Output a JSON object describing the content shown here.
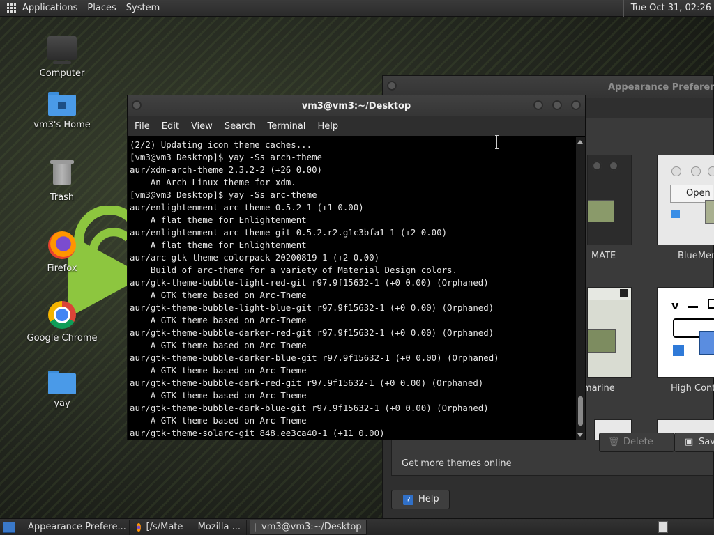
{
  "top_panel": {
    "menus": [
      "Applications",
      "Places",
      "System"
    ],
    "clock": "Tue Oct 31, 02:26"
  },
  "desktop_icons": [
    {
      "label": "Computer",
      "icon": "computer-icon"
    },
    {
      "label": "vm3's Home",
      "icon": "home-folder-icon"
    },
    {
      "label": "Trash",
      "icon": "trash-icon"
    },
    {
      "label": "Firefox",
      "icon": "firefox-icon"
    },
    {
      "label": "Google Chrome",
      "icon": "chrome-icon"
    },
    {
      "label": "yay",
      "icon": "folder-icon"
    }
  ],
  "terminal": {
    "title": "vm3@vm3:~/Desktop",
    "menu": [
      "File",
      "Edit",
      "View",
      "Search",
      "Terminal",
      "Help"
    ],
    "lines": [
      "(2/2) Updating icon theme caches...",
      "[vm3@vm3 Desktop]$ yay -Ss arch-theme",
      "aur/xdm-arch-theme 2.3.2-2 (+26 0.00)",
      "    An Arch Linux theme for xdm.",
      "[vm3@vm3 Desktop]$ yay -Ss arc-theme",
      "aur/enlightenment-arc-theme 0.5.2-1 (+1 0.00)",
      "    A flat theme for Enlightenment",
      "aur/enlightenment-arc-theme-git 0.5.2.r2.g1c3bfa1-1 (+2 0.00)",
      "    A flat theme for Enlightenment",
      "aur/arc-gtk-theme-colorpack 20200819-1 (+2 0.00)",
      "    Build of arc-theme for a variety of Material Design colors.",
      "aur/gtk-theme-bubble-light-red-git r97.9f15632-1 (+0 0.00) (Orphaned)",
      "    A GTK theme based on Arc-Theme",
      "aur/gtk-theme-bubble-light-blue-git r97.9f15632-1 (+0 0.00) (Orphaned)",
      "    A GTK theme based on Arc-Theme",
      "aur/gtk-theme-bubble-darker-red-git r97.9f15632-1 (+0 0.00) (Orphaned)",
      "    A GTK theme based on Arc-Theme",
      "aur/gtk-theme-bubble-darker-blue-git r97.9f15632-1 (+0 0.00) (Orphaned)",
      "    A GTK theme based on Arc-Theme",
      "aur/gtk-theme-bubble-dark-red-git r97.9f15632-1 (+0 0.00) (Orphaned)",
      "    A GTK theme based on Arc-Theme",
      "aur/gtk-theme-bubble-dark-blue-git r97.9f15632-1 (+0 0.00) (Orphaned)",
      "    A GTK theme based on Arc-Theme",
      "aur/gtk-theme-solarc-git 848.ee3ca40-1 (+11 0.00)"
    ]
  },
  "appearance": {
    "title": "Appearance Preferences",
    "themes": [
      "MATE",
      "BlueMenta",
      "omarine",
      "High Contr"
    ],
    "thumb_open_label": "Open",
    "delete_label": "Delete",
    "save_label": "Sav",
    "get_more": "Get more themes online",
    "help_label": "Help"
  },
  "taskbar": {
    "tasks": [
      {
        "label": "Appearance Prefere...",
        "active": false
      },
      {
        "label": "[/s/Mate — Mozilla ...",
        "active": false
      },
      {
        "label": "vm3@vm3:~/Desktop",
        "active": true
      }
    ]
  },
  "colors": {
    "accent_green": "#8dc63f",
    "folder_blue": "#4a9ae8",
    "panel": "#2b2b2b",
    "terminal_bg": "#000000"
  }
}
